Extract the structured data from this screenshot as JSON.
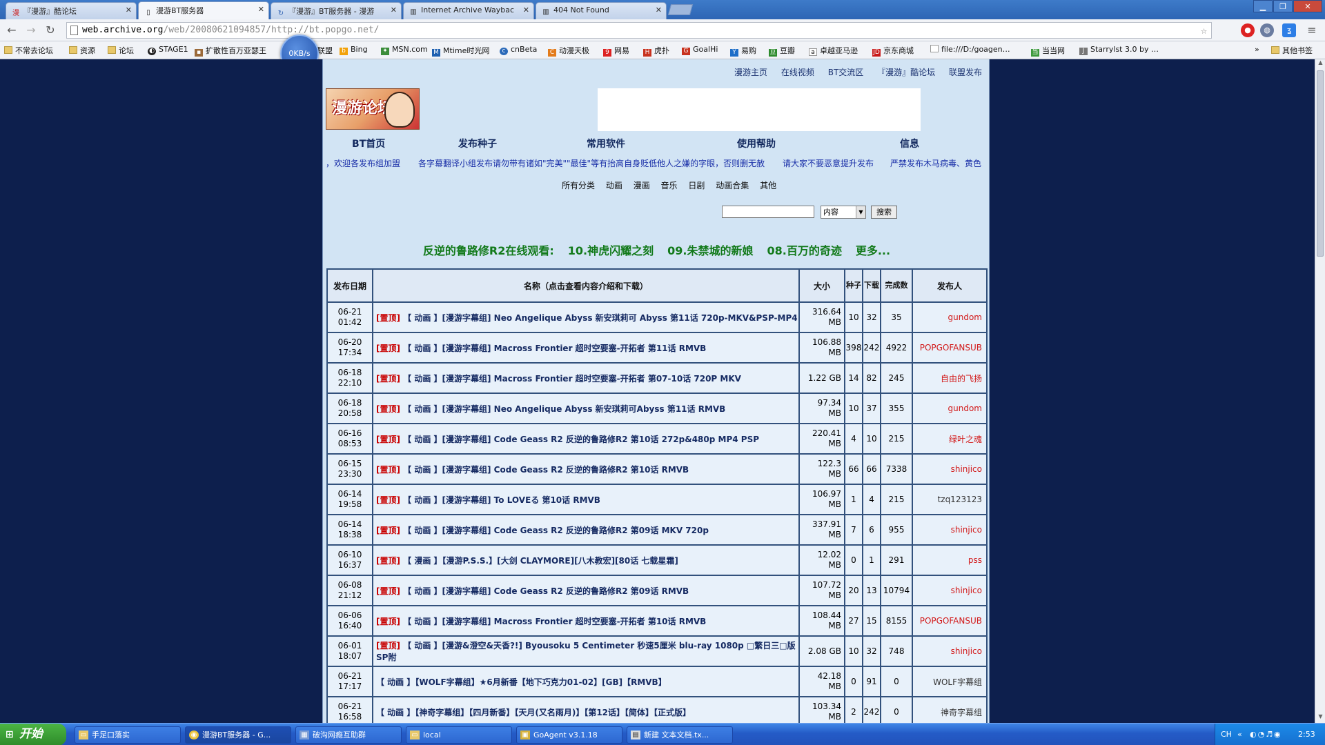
{
  "browser": {
    "tabs": [
      {
        "label": "『漫游』酷论坛",
        "icon": "漫"
      },
      {
        "label": "漫游BT服务器",
        "icon": "▯"
      },
      {
        "label": "『漫游』BT服务器 - 漫游",
        "icon": "↻"
      },
      {
        "label": "Internet Archive Waybac",
        "icon": "▥"
      },
      {
        "label": "404 Not Found",
        "icon": "▥"
      }
    ],
    "url_host": "web.archive.org",
    "url_path": "/web/20080621094857/http://bt.popgo.net/",
    "speed_indicator": "0KB/s",
    "bookmarks": [
      {
        "label": "不常去论坛",
        "kind": "folder"
      },
      {
        "label": "资源",
        "kind": "folder"
      },
      {
        "label": "论坛",
        "kind": "folder"
      },
      {
        "label": "STAGE1",
        "kind": "site"
      },
      {
        "label": "扩散性百万亚瑟王",
        "kind": "site"
      },
      {
        "label": "联盟",
        "kind": "site"
      },
      {
        "label": "Bing",
        "kind": "site"
      },
      {
        "label": "MSN.com",
        "kind": "site"
      },
      {
        "label": "Mtime时光网",
        "kind": "site"
      },
      {
        "label": "cnBeta",
        "kind": "site"
      },
      {
        "label": "动漫天极",
        "kind": "site"
      },
      {
        "label": "网易",
        "kind": "site"
      },
      {
        "label": "虎扑",
        "kind": "site"
      },
      {
        "label": "GoalHi",
        "kind": "site"
      },
      {
        "label": "易购",
        "kind": "site"
      },
      {
        "label": "豆瓣",
        "kind": "site"
      },
      {
        "label": "卓越亚马逊",
        "kind": "site"
      },
      {
        "label": "京东商城",
        "kind": "site"
      },
      {
        "label": "file:///D:/goagen…",
        "kind": "page"
      },
      {
        "label": "当当网",
        "kind": "site"
      },
      {
        "label": "Starrylst 3.0 by …",
        "kind": "site"
      }
    ],
    "bookmarks_overflow": "»",
    "other_bookmarks": "其他书签"
  },
  "page": {
    "top_links": [
      "漫游主页",
      "在线视频",
      "BT交流区",
      "『漫游』酷论坛",
      "联盟发布"
    ],
    "logo_text": "漫游论坛",
    "main_nav": [
      "BT首页",
      "发布种子",
      "常用软件",
      "使用帮助",
      "信息"
    ],
    "notices": [
      "，欢迎各发布组加盟",
      "各字幕翻译小组发布请勿带有诸如\"完美\"\"最佳\"等有抬高自身贬低他人之嫌的字眼，否则删无赦",
      "请大家不要恶意提升发布",
      "严禁发布木马病毒、黄色"
    ],
    "categories": [
      "所有分类",
      "动画",
      "漫画",
      "音乐",
      "日剧",
      "动画合集",
      "其他"
    ],
    "search": {
      "input_value": "",
      "select_value": "内容",
      "button_label": "搜索"
    },
    "marquee": [
      "反逆的鲁路修R2在线观看:",
      "10.神虎闪耀之刻",
      "09.朱禁城的新娘",
      "08.百万的奇迹",
      "更多..."
    ]
  },
  "table": {
    "headers": [
      "发布日期",
      "名称（点击查看内容介绍和下载）",
      "大小",
      "种子",
      "下载",
      "完成数",
      "发布人"
    ],
    "rows": [
      {
        "date": "06-21",
        "time": "01:42",
        "top": "[置顶]",
        "name": "【 动画 】[漫游字幕组] Neo Angelique Abyss 新安琪莉可 Abyss 第11话 720p-MKV&PSP-MP4",
        "size": "316.64",
        "unit": "MB",
        "seeds": "10",
        "leech": "32",
        "done": "35",
        "user": "gundom",
        "user_color": "red"
      },
      {
        "date": "06-20",
        "time": "17:34",
        "top": "[置顶]",
        "name": "【 动画 】[漫游字幕组] Macross Frontier 超时空要塞-开拓者 第11话 RMVB",
        "size": "106.88",
        "unit": "MB",
        "seeds": "398",
        "leech": "242",
        "done": "4922",
        "user": "POPGOFANSUB",
        "user_color": "red"
      },
      {
        "date": "06-18",
        "time": "22:10",
        "top": "[置顶]",
        "name": "【 动画 】[漫游字幕组] Macross Frontier 超时空要塞-开拓者 第07-10话 720P MKV",
        "size": "1.22 GB",
        "unit": "",
        "seeds": "14",
        "leech": "82",
        "done": "245",
        "user": "自由的飞扬",
        "user_color": "red"
      },
      {
        "date": "06-18",
        "time": "20:58",
        "top": "[置顶]",
        "name": "【 动画 】[漫游字幕组] Neo Angelique Abyss 新安琪莉可Abyss 第11话 RMVB",
        "size": "97.34",
        "unit": "MB",
        "seeds": "10",
        "leech": "37",
        "done": "355",
        "user": "gundom",
        "user_color": "red"
      },
      {
        "date": "06-16",
        "time": "08:53",
        "top": "[置顶]",
        "name": "【 动画 】[漫游字幕组] Code Geass R2 反逆的鲁路修R2 第10话 272p&480p MP4 PSP",
        "size": "220.41",
        "unit": "MB",
        "seeds": "4",
        "leech": "10",
        "done": "215",
        "user": "绿叶之魂",
        "user_color": "red"
      },
      {
        "date": "06-15",
        "time": "23:30",
        "top": "[置顶]",
        "name": "【 动画 】[漫游字幕组] Code Geass R2 反逆的鲁路修R2 第10话 RMVB",
        "size": "122.3",
        "unit": "MB",
        "seeds": "66",
        "leech": "66",
        "done": "7338",
        "user": "shinjico",
        "user_color": "red"
      },
      {
        "date": "06-14",
        "time": "19:58",
        "top": "[置顶]",
        "name": "【 动画 】[漫游字幕组] To LOVEる 第10话 RMVB",
        "size": "106.97",
        "unit": "MB",
        "seeds": "1",
        "leech": "4",
        "done": "215",
        "user": "tzq123123",
        "user_color": "grey"
      },
      {
        "date": "06-14",
        "time": "18:38",
        "top": "[置顶]",
        "name": "【 动画 】[漫游字幕组] Code Geass R2 反逆的鲁路修R2 第09话 MKV 720p",
        "size": "337.91",
        "unit": "MB",
        "seeds": "7",
        "leech": "6",
        "done": "955",
        "user": "shinjico",
        "user_color": "red"
      },
      {
        "date": "06-10",
        "time": "16:37",
        "top": "[置顶]",
        "name": "【 漫画 】【漫游P.S.S.】[大剑 CLAYMORE][八木教宏][80话 七载星霜]",
        "size": "12.02",
        "unit": "MB",
        "seeds": "0",
        "leech": "1",
        "done": "291",
        "user": "pss",
        "user_color": "red"
      },
      {
        "date": "06-08",
        "time": "21:12",
        "top": "[置顶]",
        "name": "【 动画 】[漫游字幕组] Code Geass R2 反逆的鲁路修R2 第09话 RMVB",
        "size": "107.72",
        "unit": "MB",
        "seeds": "20",
        "leech": "13",
        "done": "10794",
        "user": "shinjico",
        "user_color": "red"
      },
      {
        "date": "06-06",
        "time": "16:40",
        "top": "[置顶]",
        "name": "【 动画 】[漫游字幕组] Macross Frontier 超时空要塞-开拓者 第10话 RMVB",
        "size": "108.44",
        "unit": "MB",
        "seeds": "27",
        "leech": "15",
        "done": "8155",
        "user": "POPGOFANSUB",
        "user_color": "red"
      },
      {
        "date": "06-01",
        "time": "18:07",
        "top": "[置顶]",
        "name": "【 动画 】[漫游&澄空&天香?!] Byousoku 5 Centimeter 秒速5厘米 blu-ray 1080p □繁日三□版 SP附",
        "size": "2.08 GB",
        "unit": "",
        "seeds": "10",
        "leech": "32",
        "done": "748",
        "user": "shinjico",
        "user_color": "red"
      },
      {
        "date": "06-21",
        "time": "17:17",
        "top": "",
        "name": "【 动画 】【WOLF字幕组】★6月新番【地下巧克力01-02】[GB]【RMVB】",
        "size": "42.18",
        "unit": "MB",
        "seeds": "0",
        "leech": "91",
        "done": "0",
        "user": "WOLF字幕组",
        "user_color": "grey"
      },
      {
        "date": "06-21",
        "time": "16:58",
        "top": "",
        "name": "【 动画 】【神奇字幕组】【四月新番】【天月(又名雨月)】【第12话】【简体】【正式版】",
        "size": "103.34",
        "unit": "MB",
        "seeds": "2",
        "leech": "242",
        "done": "0",
        "user": "神奇字幕组",
        "user_color": "grey"
      }
    ]
  },
  "taskbar": {
    "start_label": "开始",
    "tasks": [
      {
        "label": "手足口落实",
        "icon": "▭"
      },
      {
        "label": "漫游BT服务器 - G...",
        "icon": "◉"
      },
      {
        "label": "破沟网瘾互助群",
        "icon": "▦"
      },
      {
        "label": "local",
        "icon": "▭"
      },
      {
        "label": "GoAgent v3.1.18",
        "icon": "▣"
      },
      {
        "label": "新建 文本文档.tx...",
        "icon": "▤"
      }
    ],
    "tray_lang": "CH",
    "clock": "2:53"
  }
}
